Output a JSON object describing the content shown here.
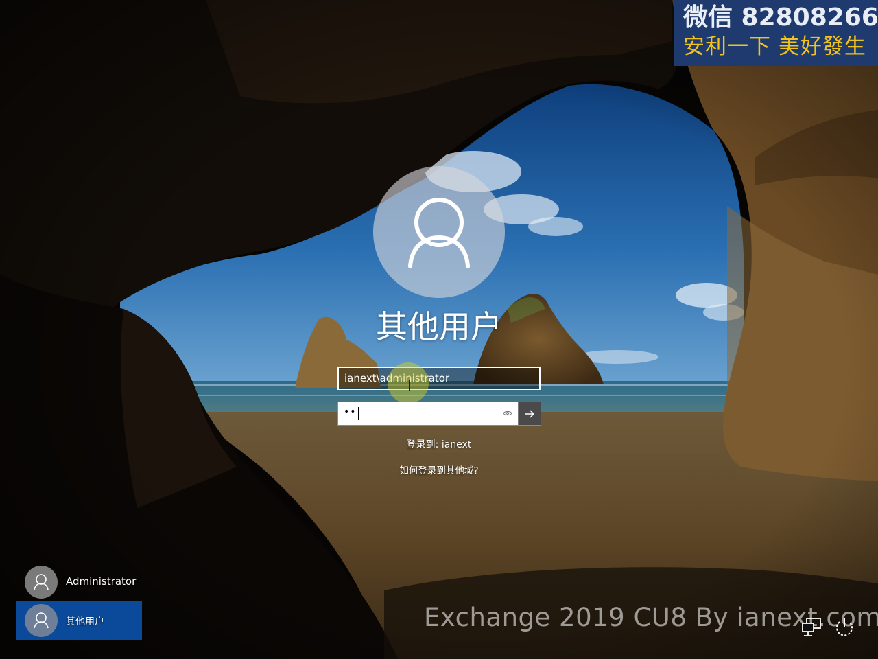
{
  "watermark": {
    "line1": "微信 82808266",
    "line2": "安利一下 美好發生"
  },
  "login": {
    "user_title": "其他用户",
    "username_value": "ianext\\administrator",
    "password_dots": "••",
    "signin_to": "登录到: ianext",
    "other_domain_link": "如何登录到其他域?"
  },
  "user_list": [
    {
      "name": "Administrator",
      "selected": false
    },
    {
      "name": "其他用户",
      "selected": true
    }
  ],
  "footer_watermark": "Exchange 2019 CU8 By ianext.com",
  "icons": {
    "avatar": "user-silhouette-icon",
    "reveal": "eye-icon",
    "submit": "arrow-right-icon",
    "network": "network-icon",
    "power": "power-icon"
  },
  "colors": {
    "watermark_bg": "#1f3a6e",
    "watermark_accent": "#f2c419",
    "selected_user_bg": "#0b4a9a"
  }
}
